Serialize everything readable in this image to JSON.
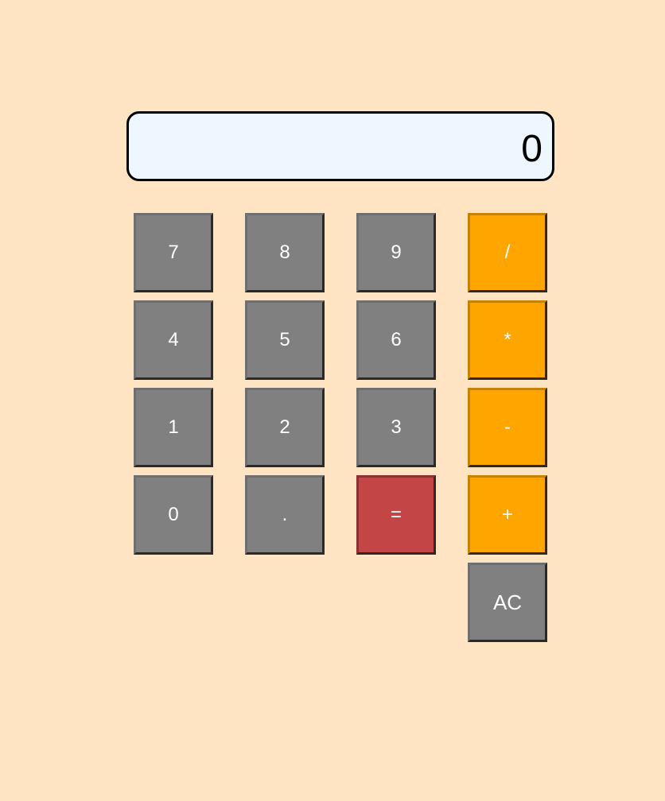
{
  "display": {
    "value": "0"
  },
  "keys": {
    "seven": "7",
    "eight": "8",
    "nine": "9",
    "divide": "/",
    "four": "4",
    "five": "5",
    "six": "6",
    "multiply": "*",
    "one": "1",
    "two": "2",
    "three": "3",
    "subtract": "-",
    "zero": "0",
    "decimal": ".",
    "equals": "=",
    "add": "+",
    "clear": "AC"
  },
  "colors": {
    "background": "#ffe4c4",
    "display_bg": "#eef6ff",
    "number_key": "#808080",
    "operator_key": "#ffa500",
    "equals_key": "#c44545",
    "key_text": "#ffffff"
  }
}
